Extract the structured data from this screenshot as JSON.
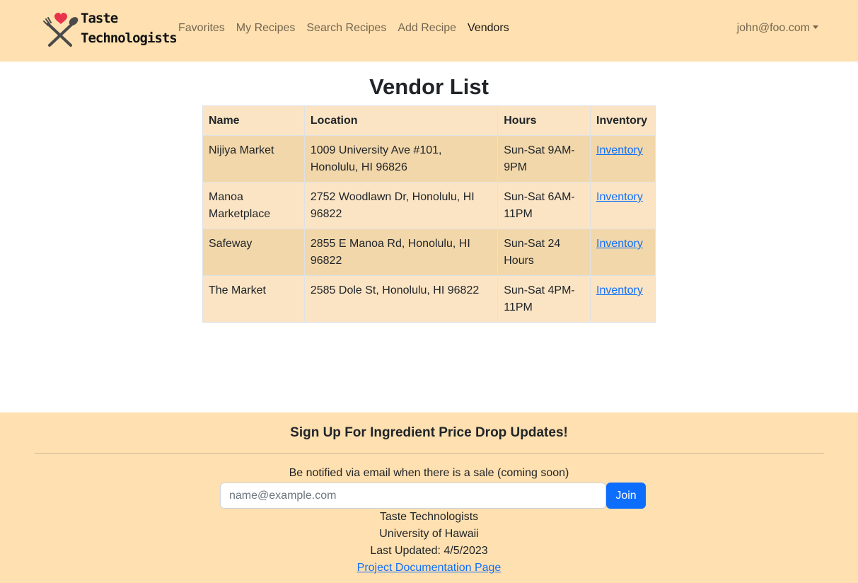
{
  "brand": {
    "line1": "Taste",
    "line2": "Technologists",
    "logo_icon": "fork-spoon-heart-icon"
  },
  "nav": {
    "links": [
      {
        "label": "Favorites"
      },
      {
        "label": "My Recipes"
      },
      {
        "label": "Search Recipes"
      },
      {
        "label": "Add Recipe"
      },
      {
        "label": "Vendors",
        "active": true
      }
    ],
    "user": "john@foo.com"
  },
  "main": {
    "title": "Vendor List",
    "table": {
      "headers": [
        "Name",
        "Location",
        "Hours",
        "Inventory"
      ],
      "rows": [
        {
          "name": "Nijiya Market",
          "location": "1009 University Ave #101, Honolulu, HI 96826",
          "hours": "Sun-Sat 9AM-9PM",
          "inventory": "Inventory"
        },
        {
          "name": "Manoa Marketplace",
          "location": "2752 Woodlawn Dr, Honolulu, HI 96822",
          "hours": "Sun-Sat 6AM-11PM",
          "inventory": "Inventory"
        },
        {
          "name": "Safeway",
          "location": "2855 E Manoa Rd, Honolulu, HI 96822",
          "hours": "Sun-Sat 24 Hours",
          "inventory": "Inventory"
        },
        {
          "name": "The Market",
          "location": "2585 Dole St, Honolulu, HI 96822",
          "hours": "Sun-Sat 4PM-11PM",
          "inventory": "Inventory"
        }
      ]
    }
  },
  "footer": {
    "heading": "Sign Up For Ingredient Price Drop Updates!",
    "subtext": "Be notified via email when there is a sale (coming soon)",
    "email_placeholder": "name@example.com",
    "join_label": "Join",
    "org": "Taste Technologists",
    "university": "University of Hawaii",
    "last_updated": "Last Updated: 4/5/2023",
    "docs_link": "Project Documentation Page"
  },
  "colors": {
    "header_bg": "#ffe0b0",
    "accent": "#0d6efd",
    "heart": "#e8344a"
  }
}
